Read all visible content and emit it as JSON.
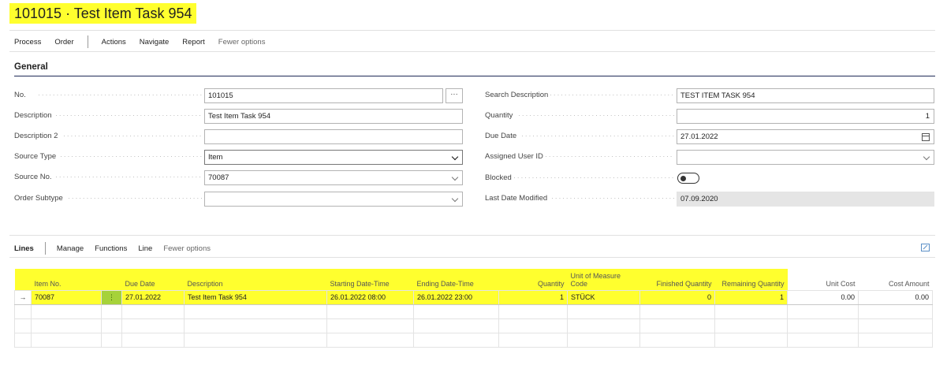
{
  "page": {
    "title": "101015 · Test Item Task 954"
  },
  "actionbar": {
    "items": [
      "Process",
      "Order",
      "Actions",
      "Navigate",
      "Report"
    ],
    "fewer": "Fewer options"
  },
  "general": {
    "section_title": "General",
    "left": {
      "no": {
        "label": "No.",
        "value": "101015",
        "ellipsis": "···"
      },
      "description": {
        "label": "Description",
        "value": "Test Item Task 954"
      },
      "description2": {
        "label": "Description 2",
        "value": ""
      },
      "source_type": {
        "label": "Source Type",
        "value": "Item"
      },
      "source_no": {
        "label": "Source No.",
        "value": "70087"
      },
      "order_subtype": {
        "label": "Order Subtype",
        "value": ""
      }
    },
    "right": {
      "search_description": {
        "label": "Search Description",
        "value": "TEST ITEM TASK 954"
      },
      "quantity": {
        "label": "Quantity",
        "value": "1"
      },
      "due_date": {
        "label": "Due Date",
        "value": "27.01.2022"
      },
      "assigned_user": {
        "label": "Assigned User ID",
        "value": ""
      },
      "blocked": {
        "label": "Blocked",
        "value": false
      },
      "last_modified": {
        "label": "Last Date Modified",
        "value": "07.09.2020"
      }
    }
  },
  "lines": {
    "bar": {
      "title": "Lines",
      "items": [
        "Manage",
        "Functions",
        "Line"
      ],
      "fewer": "Fewer options"
    },
    "columns": {
      "item_no": "Item No.",
      "due_date": "Due Date",
      "description": "Description",
      "starting": "Starting Date-Time",
      "ending": "Ending Date-Time",
      "quantity": "Quantity",
      "uom_line1": "Unit of Measure",
      "uom_line2": "Code",
      "finished": "Finished Quantity",
      "remaining": "Remaining Quantity",
      "unit_cost": "Unit Cost",
      "cost_amount": "Cost Amount"
    },
    "row": {
      "arrow": "→",
      "item_no": "70087",
      "menu": "⋮",
      "due_date": "27.01.2022",
      "description": "Test Item Task 954",
      "starting": "26.01.2022 08:00",
      "ending": "26.01.2022 23:00",
      "quantity": "1",
      "uom": "STÜCK",
      "finished": "0",
      "remaining": "1",
      "unit_cost": "0.00",
      "cost_amount": "0.00"
    }
  },
  "colors": {
    "highlight": "#ffff2e",
    "green_cell": "#a6d23a",
    "section_rule": "#1f2b57"
  }
}
